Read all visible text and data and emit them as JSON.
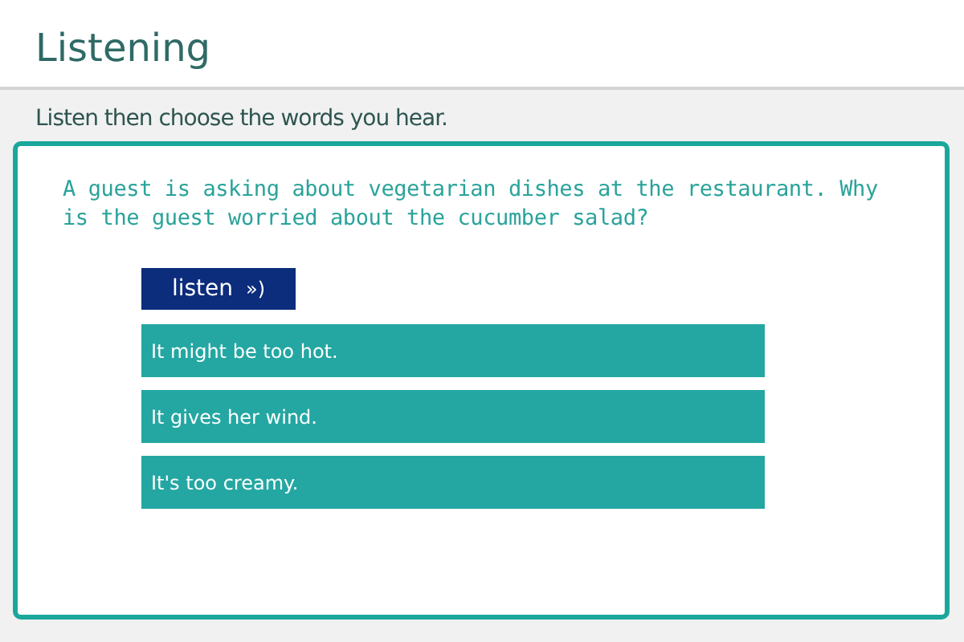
{
  "title": "Listening",
  "instruction": "Listen then choose the words you hear.",
  "question": "A guest is asking about vegetarian dishes at the restaurant. Why is the guest worried about the cucumber salad?",
  "listen_button": {
    "label": "listen",
    "icon": "»)"
  },
  "options": [
    "It might be too hot.",
    "It gives her wind.",
    "It's too creamy."
  ]
}
